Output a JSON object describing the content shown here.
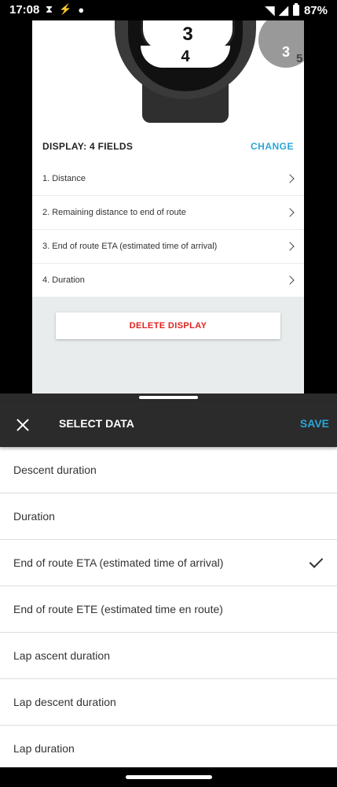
{
  "status_bar": {
    "time": "17:08",
    "battery": "87%"
  },
  "watch": {
    "top_field": "3",
    "bottom_field": "4",
    "mini_field": "3",
    "mini_next": "5"
  },
  "display": {
    "title": "DISPLAY: 4 FIELDS",
    "change_label": "CHANGE",
    "fields": [
      {
        "label": "1. Distance"
      },
      {
        "label": "2. Remaining distance to end of route"
      },
      {
        "label": "3. End of route ETA (estimated time of arrival)"
      },
      {
        "label": "4. Duration"
      }
    ],
    "delete_label": "DELETE DISPLAY"
  },
  "sheet": {
    "title": "SELECT DATA",
    "save_label": "SAVE",
    "items": [
      {
        "label": "Descent duration",
        "selected": false
      },
      {
        "label": "Duration",
        "selected": false
      },
      {
        "label": "End of route ETA (estimated time of arrival)",
        "selected": true
      },
      {
        "label": "End of route ETE (estimated time en route)",
        "selected": false
      },
      {
        "label": "Lap ascent duration",
        "selected": false
      },
      {
        "label": "Lap descent duration",
        "selected": false
      },
      {
        "label": "Lap duration",
        "selected": false
      }
    ]
  },
  "colors": {
    "accent": "#2aa6d9",
    "danger": "#e0211f",
    "header_bg": "#2b2b2b"
  }
}
